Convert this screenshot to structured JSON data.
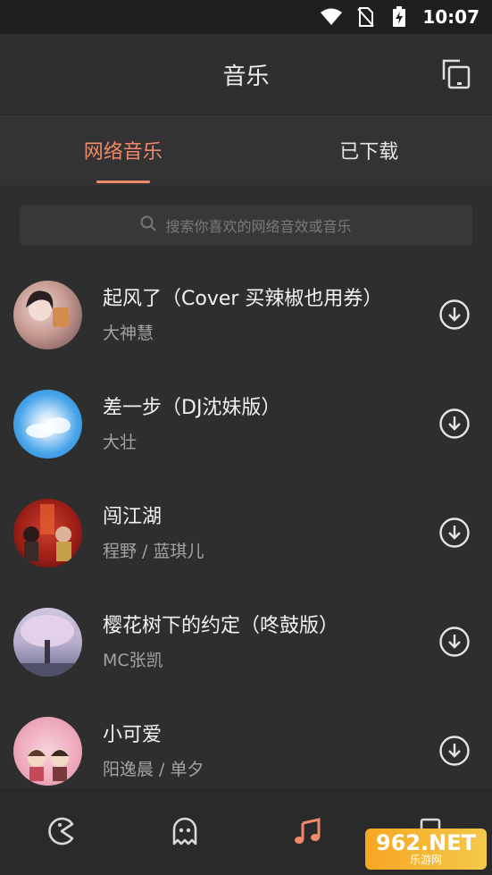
{
  "status_bar": {
    "time": "10:07"
  },
  "app_bar": {
    "title": "音乐"
  },
  "tabs": [
    {
      "label": "网络音乐",
      "active": true
    },
    {
      "label": "已下载",
      "active": false
    }
  ],
  "search": {
    "placeholder": "搜索你喜欢的网络音效或音乐"
  },
  "songs": [
    {
      "title": "起风了（Cover 买辣椒也用券）",
      "artist": "大神慧"
    },
    {
      "title": "差一步（DJ沈妹版）",
      "artist": "大壮"
    },
    {
      "title": "闯江湖",
      "artist": "程野 / 蓝琪儿"
    },
    {
      "title": "樱花树下的约定（咚鼓版）",
      "artist": "MC张凯"
    },
    {
      "title": "小可爱",
      "artist": "阳逸晨 / 单夕"
    }
  ],
  "watermark": {
    "line1": "962.NET",
    "line2": "乐游网"
  },
  "colors": {
    "accent": "#ef8a6a",
    "background": "#2e2e2e"
  }
}
